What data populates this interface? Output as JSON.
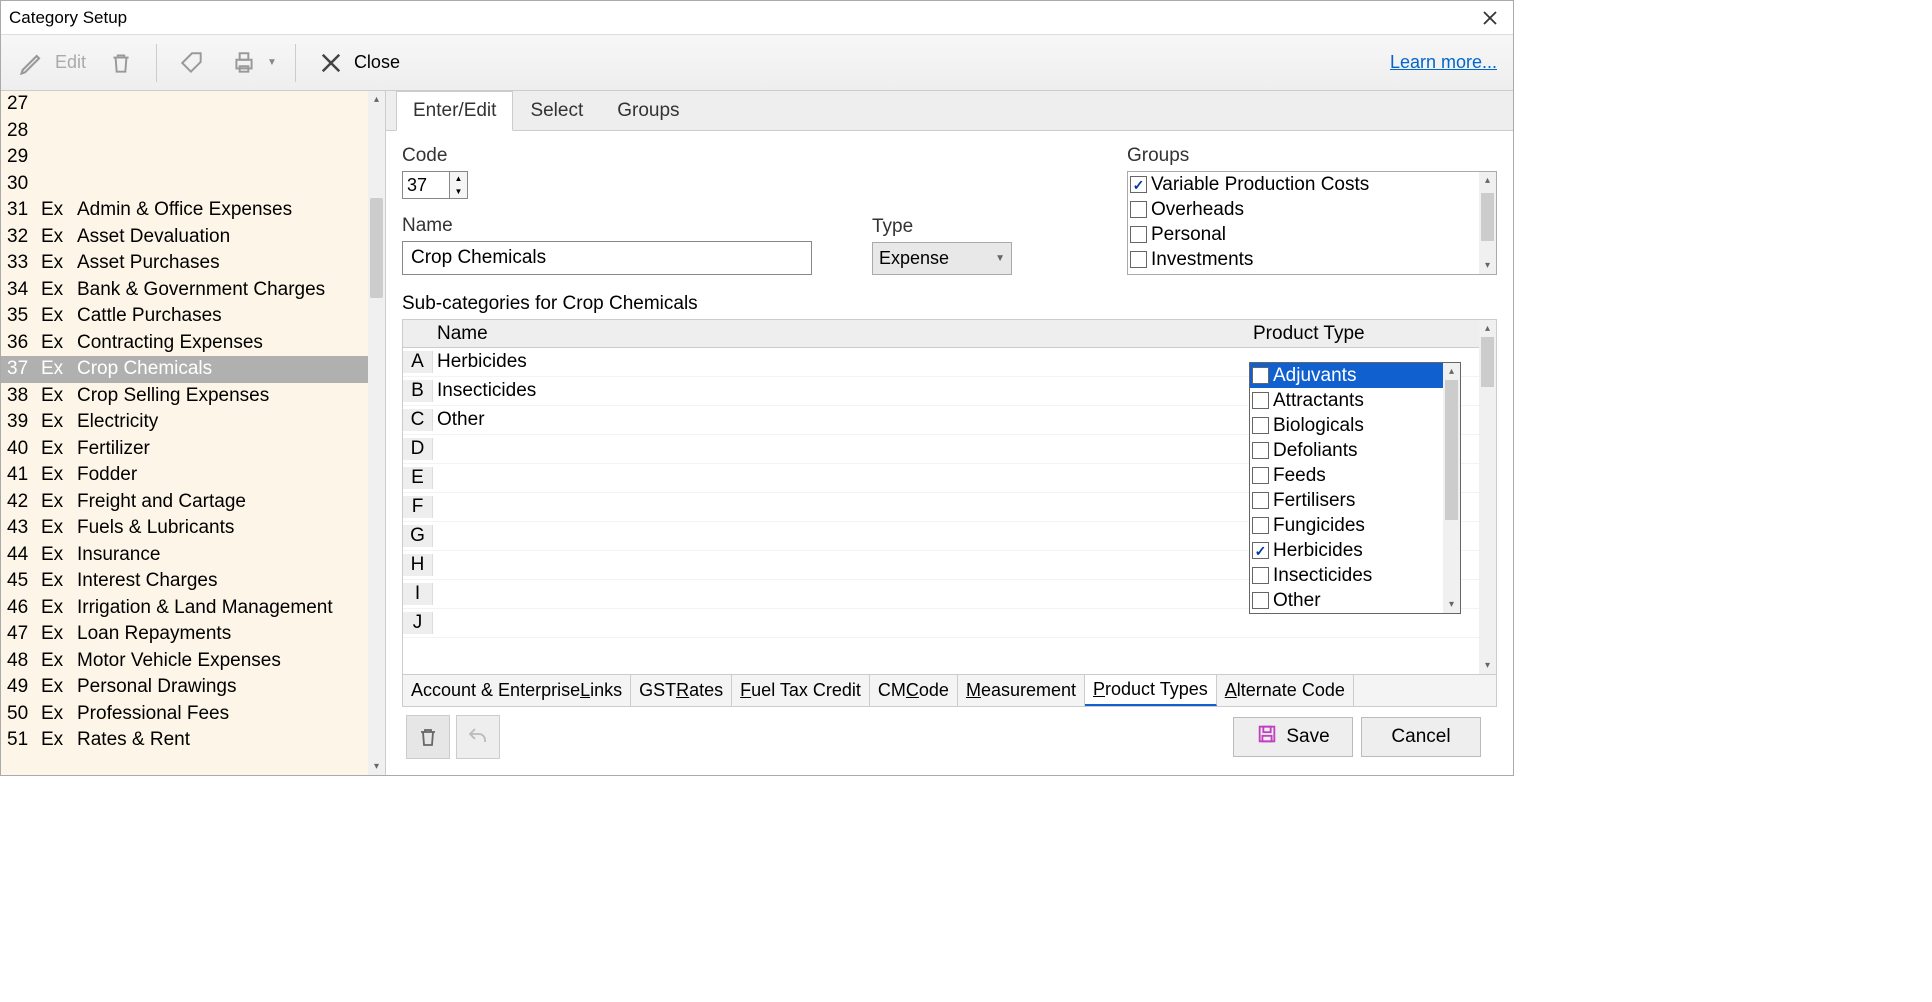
{
  "window": {
    "title": "Category Setup",
    "learn_more": "Learn more..."
  },
  "toolbar": {
    "edit": "Edit",
    "close": "Close"
  },
  "sidebar": {
    "items": [
      {
        "num": "27",
        "type": "",
        "name": ""
      },
      {
        "num": "28",
        "type": "",
        "name": ""
      },
      {
        "num": "29",
        "type": "",
        "name": ""
      },
      {
        "num": "30",
        "type": "",
        "name": ""
      },
      {
        "num": "31",
        "type": "Ex",
        "name": "Admin & Office Expenses"
      },
      {
        "num": "32",
        "type": "Ex",
        "name": "Asset Devaluation"
      },
      {
        "num": "33",
        "type": "Ex",
        "name": "Asset Purchases"
      },
      {
        "num": "34",
        "type": "Ex",
        "name": "Bank  & Government Charges"
      },
      {
        "num": "35",
        "type": "Ex",
        "name": "Cattle Purchases"
      },
      {
        "num": "36",
        "type": "Ex",
        "name": "Contracting Expenses"
      },
      {
        "num": "37",
        "type": "Ex",
        "name": "Crop Chemicals",
        "selected": true
      },
      {
        "num": "38",
        "type": "Ex",
        "name": "Crop Selling Expenses"
      },
      {
        "num": "39",
        "type": "Ex",
        "name": "Electricity"
      },
      {
        "num": "40",
        "type": "Ex",
        "name": "Fertilizer"
      },
      {
        "num": "41",
        "type": "Ex",
        "name": "Fodder"
      },
      {
        "num": "42",
        "type": "Ex",
        "name": "Freight and Cartage"
      },
      {
        "num": "43",
        "type": "Ex",
        "name": "Fuels & Lubricants"
      },
      {
        "num": "44",
        "type": "Ex",
        "name": "Insurance"
      },
      {
        "num": "45",
        "type": "Ex",
        "name": "Interest Charges"
      },
      {
        "num": "46",
        "type": "Ex",
        "name": "Irrigation & Land Management"
      },
      {
        "num": "47",
        "type": "Ex",
        "name": "Loan Repayments"
      },
      {
        "num": "48",
        "type": "Ex",
        "name": "Motor Vehicle Expenses"
      },
      {
        "num": "49",
        "type": "Ex",
        "name": "Personal Drawings"
      },
      {
        "num": "50",
        "type": "Ex",
        "name": "Professional Fees"
      },
      {
        "num": "51",
        "type": "Ex",
        "name": "Rates & Rent"
      }
    ]
  },
  "tabs": {
    "enter_edit": "Enter/Edit",
    "select": "Select",
    "groups": "Groups"
  },
  "form": {
    "code_label": "Code",
    "code_value": "37",
    "name_label": "Name",
    "name_value": "Crop Chemicals",
    "type_label": "Type",
    "type_value": "Expense",
    "groups_label": "Groups",
    "groups": [
      {
        "label": "Variable Production Costs",
        "checked": true
      },
      {
        "label": "Overheads",
        "checked": false
      },
      {
        "label": "Personal",
        "checked": false
      },
      {
        "label": "Investments",
        "checked": false
      }
    ],
    "subcat_label": "Sub-categories for Crop Chemicals",
    "grid_headers": {
      "name": "Name",
      "ptype": "Product Type"
    },
    "sub_rows": [
      {
        "letter": "A",
        "name": "Herbicides"
      },
      {
        "letter": "B",
        "name": "Insecticides"
      },
      {
        "letter": "C",
        "name": "Other"
      },
      {
        "letter": "D",
        "name": ""
      },
      {
        "letter": "E",
        "name": ""
      },
      {
        "letter": "F",
        "name": ""
      },
      {
        "letter": "G",
        "name": ""
      },
      {
        "letter": "H",
        "name": ""
      },
      {
        "letter": "I",
        "name": ""
      },
      {
        "letter": "J",
        "name": ""
      }
    ],
    "product_types": [
      {
        "label": "Adjuvants",
        "checked": false,
        "hl": true
      },
      {
        "label": "Attractants",
        "checked": false
      },
      {
        "label": "Biologicals",
        "checked": false
      },
      {
        "label": "Defoliants",
        "checked": false
      },
      {
        "label": "Feeds",
        "checked": false
      },
      {
        "label": "Fertilisers",
        "checked": false
      },
      {
        "label": "Fungicides",
        "checked": false
      },
      {
        "label": "Herbicides",
        "checked": true
      },
      {
        "label": "Insecticides",
        "checked": false
      },
      {
        "label": "Other",
        "checked": false
      }
    ]
  },
  "bottom_tabs": [
    {
      "pre": "Account & Enterprise ",
      "ul": "L",
      "post": "inks"
    },
    {
      "pre": "GST ",
      "ul": "R",
      "post": "ates"
    },
    {
      "pre": "",
      "ul": "F",
      "post": "uel Tax Credit"
    },
    {
      "pre": "CM ",
      "ul": "C",
      "post": "ode"
    },
    {
      "pre": "",
      "ul": "M",
      "post": "easurement"
    },
    {
      "pre": "",
      "ul": "P",
      "post": "roduct Types",
      "active": true
    },
    {
      "pre": "",
      "ul": "A",
      "post": "lternate Code"
    }
  ],
  "footer": {
    "save": "Save",
    "cancel": "Cancel"
  }
}
